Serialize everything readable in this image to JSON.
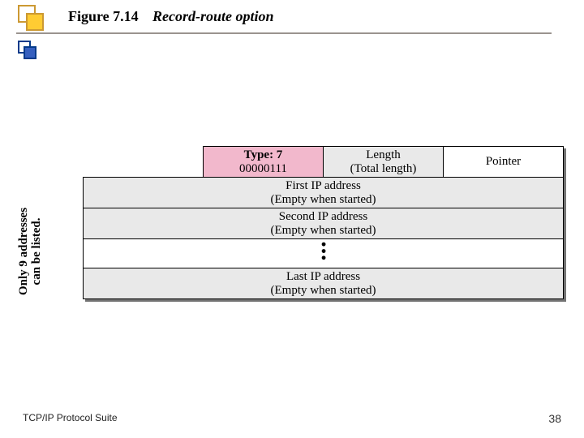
{
  "header": {
    "fig_label": "Figure 7.14",
    "fig_title": "Record-route option"
  },
  "side_note": {
    "line1": "Only 9 addresses",
    "line2": "can be listed."
  },
  "table": {
    "type": {
      "label": "Type: 7",
      "bits": "00000111"
    },
    "length": {
      "label": "Length",
      "sub": "(Total length)"
    },
    "pointer": {
      "label": "Pointer"
    },
    "rows": [
      {
        "title": "First IP address",
        "sub": "(Empty when started)"
      },
      {
        "title": "Second IP address",
        "sub": "(Empty when started)"
      },
      {
        "title": "Last IP address",
        "sub": "(Empty when started)"
      }
    ],
    "dots": "•••"
  },
  "footer": {
    "left": "TCP/IP Protocol Suite",
    "page": "38"
  }
}
